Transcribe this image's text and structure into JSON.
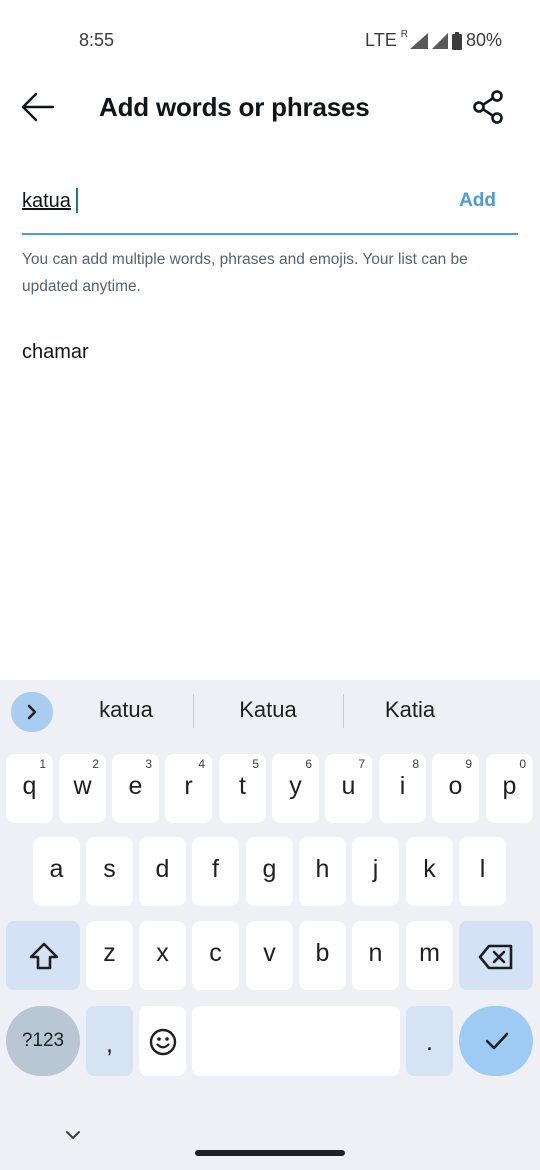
{
  "status_bar": {
    "time": "8:55",
    "network": "LTE",
    "roaming": "R",
    "battery": "80%"
  },
  "header": {
    "title": "Add words or phrases",
    "back_icon": "arrow-left-icon",
    "share_icon": "share-icon"
  },
  "input": {
    "value": "katua",
    "add_label": "Add",
    "helper_text": "You can add multiple words, phrases and emojis. Your list can be updated anytime."
  },
  "words": [
    {
      "text": "chamar"
    }
  ],
  "keyboard": {
    "suggestions": [
      "katua",
      "Katua",
      "Katia"
    ],
    "row1": [
      {
        "key": "q",
        "hint": "1"
      },
      {
        "key": "w",
        "hint": "2"
      },
      {
        "key": "e",
        "hint": "3"
      },
      {
        "key": "r",
        "hint": "4"
      },
      {
        "key": "t",
        "hint": "5"
      },
      {
        "key": "y",
        "hint": "6"
      },
      {
        "key": "u",
        "hint": "7"
      },
      {
        "key": "i",
        "hint": "8"
      },
      {
        "key": "o",
        "hint": "9"
      },
      {
        "key": "p",
        "hint": "0"
      }
    ],
    "row2": [
      "a",
      "s",
      "d",
      "f",
      "g",
      "h",
      "j",
      "k",
      "l"
    ],
    "row3": [
      "z",
      "x",
      "c",
      "v",
      "b",
      "n",
      "m"
    ],
    "symbols_label": "?123",
    "comma_label": ",",
    "period_label": ".",
    "colors": {
      "accent": "#4c9ad8",
      "keyboard_bg": "#eef0f5",
      "enter_bg": "#9dcbf3"
    }
  }
}
